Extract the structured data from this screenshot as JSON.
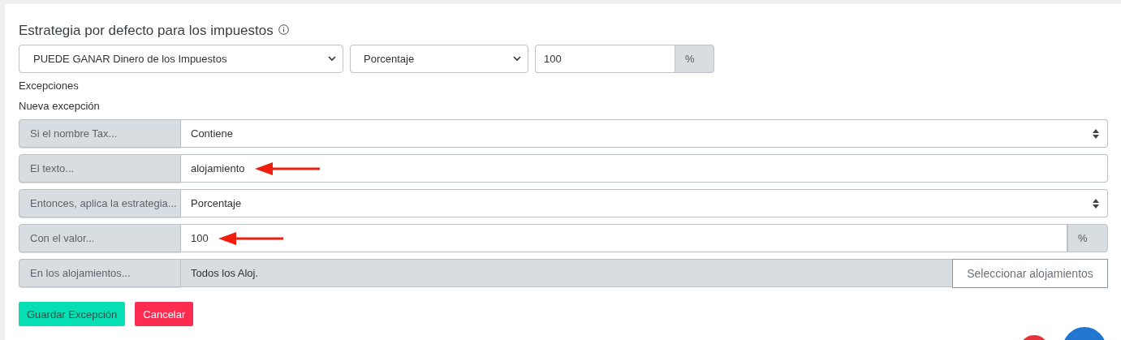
{
  "default_strategy": {
    "title": "Estrategia por defecto para los impuestos",
    "strategy": "PUEDE GANAR Dinero de los Impuestos",
    "type": "Porcentaje",
    "value": "100",
    "unit": "%"
  },
  "exceptions_label": "Excepciones",
  "new_exception_label": "Nueva excepción",
  "rows": [
    {
      "kind": "select",
      "label": "Si el nombre Tax...",
      "value": "Contiene",
      "arrow": false
    },
    {
      "kind": "text",
      "label": "El texto...",
      "value": "alojamiento",
      "arrow": true
    },
    {
      "kind": "select",
      "label": "Entonces, aplica la estrategia...",
      "value": "Porcentaje",
      "arrow": false
    },
    {
      "kind": "addon",
      "label": "Con el valor...",
      "value": "100",
      "unit": "%",
      "arrow": true
    },
    {
      "kind": "static",
      "label": "En los alojamientos...",
      "value": "Todos los Aloj.",
      "button": "Seleccionar alojamientos",
      "arrow": false
    }
  ],
  "buttons": [
    {
      "label": "Guardar Excepción",
      "kind": "save"
    },
    {
      "label": "Cancelar",
      "kind": "cancel"
    }
  ]
}
